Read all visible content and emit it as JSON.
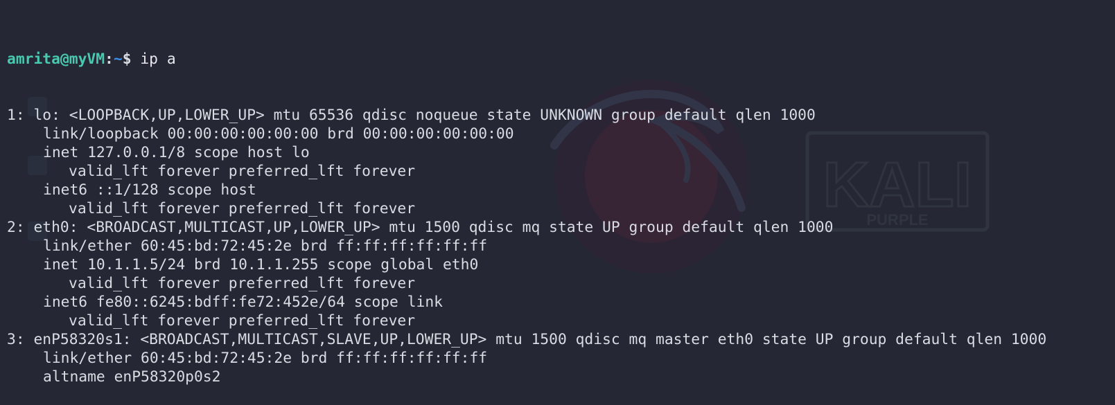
{
  "terminal": {
    "prompt": {
      "user_host": "amrita@myVM",
      "colon": ":",
      "path": "~",
      "symbol": "$",
      "command": " ip a"
    },
    "lines": [
      {
        "text": "1: lo: <LOOPBACK,UP,LOWER_UP> mtu 65536 qdisc noqueue state UNKNOWN group default qlen 1000",
        "indent": 0
      },
      {
        "text": "link/loopback 00:00:00:00:00:00 brd 00:00:00:00:00:00",
        "indent": 1
      },
      {
        "text": "inet 127.0.0.1/8 scope host lo",
        "indent": 1
      },
      {
        "text": "valid_lft forever preferred_lft forever",
        "indent": 2
      },
      {
        "text": "inet6 ::1/128 scope host",
        "indent": 1
      },
      {
        "text": "valid_lft forever preferred_lft forever",
        "indent": 2
      },
      {
        "text": "2: eth0: <BROADCAST,MULTICAST,UP,LOWER_UP> mtu 1500 qdisc mq state UP group default qlen 1000",
        "indent": 0
      },
      {
        "text": "link/ether 60:45:bd:72:45:2e brd ff:ff:ff:ff:ff:ff",
        "indent": 1
      },
      {
        "text": "inet 10.1.1.5/24 brd 10.1.1.255 scope global eth0",
        "indent": 1
      },
      {
        "text": "valid_lft forever preferred_lft forever",
        "indent": 2
      },
      {
        "text": "inet6 fe80::6245:bdff:fe72:452e/64 scope link",
        "indent": 1
      },
      {
        "text": "valid_lft forever preferred_lft forever",
        "indent": 2
      },
      {
        "text": "3: enP58320s1: <BROADCAST,MULTICAST,SLAVE,UP,LOWER_UP> mtu 1500 qdisc mq master eth0 state UP group default qlen 1000",
        "indent": 0
      },
      {
        "text": "link/ether 60:45:bd:72:45:2e brd ff:ff:ff:ff:ff:ff",
        "indent": 1
      },
      {
        "text": "altname enP58320p0s2",
        "indent": 1
      }
    ]
  },
  "wallpaper": {
    "brand": "KALI",
    "brand_sub": "PURPLE"
  },
  "colors": {
    "background": "#252834",
    "text": "#d9dce3",
    "prompt_user": "#48c9b0",
    "prompt_path": "#3b8eea",
    "logo_accent": "#3a2436"
  }
}
